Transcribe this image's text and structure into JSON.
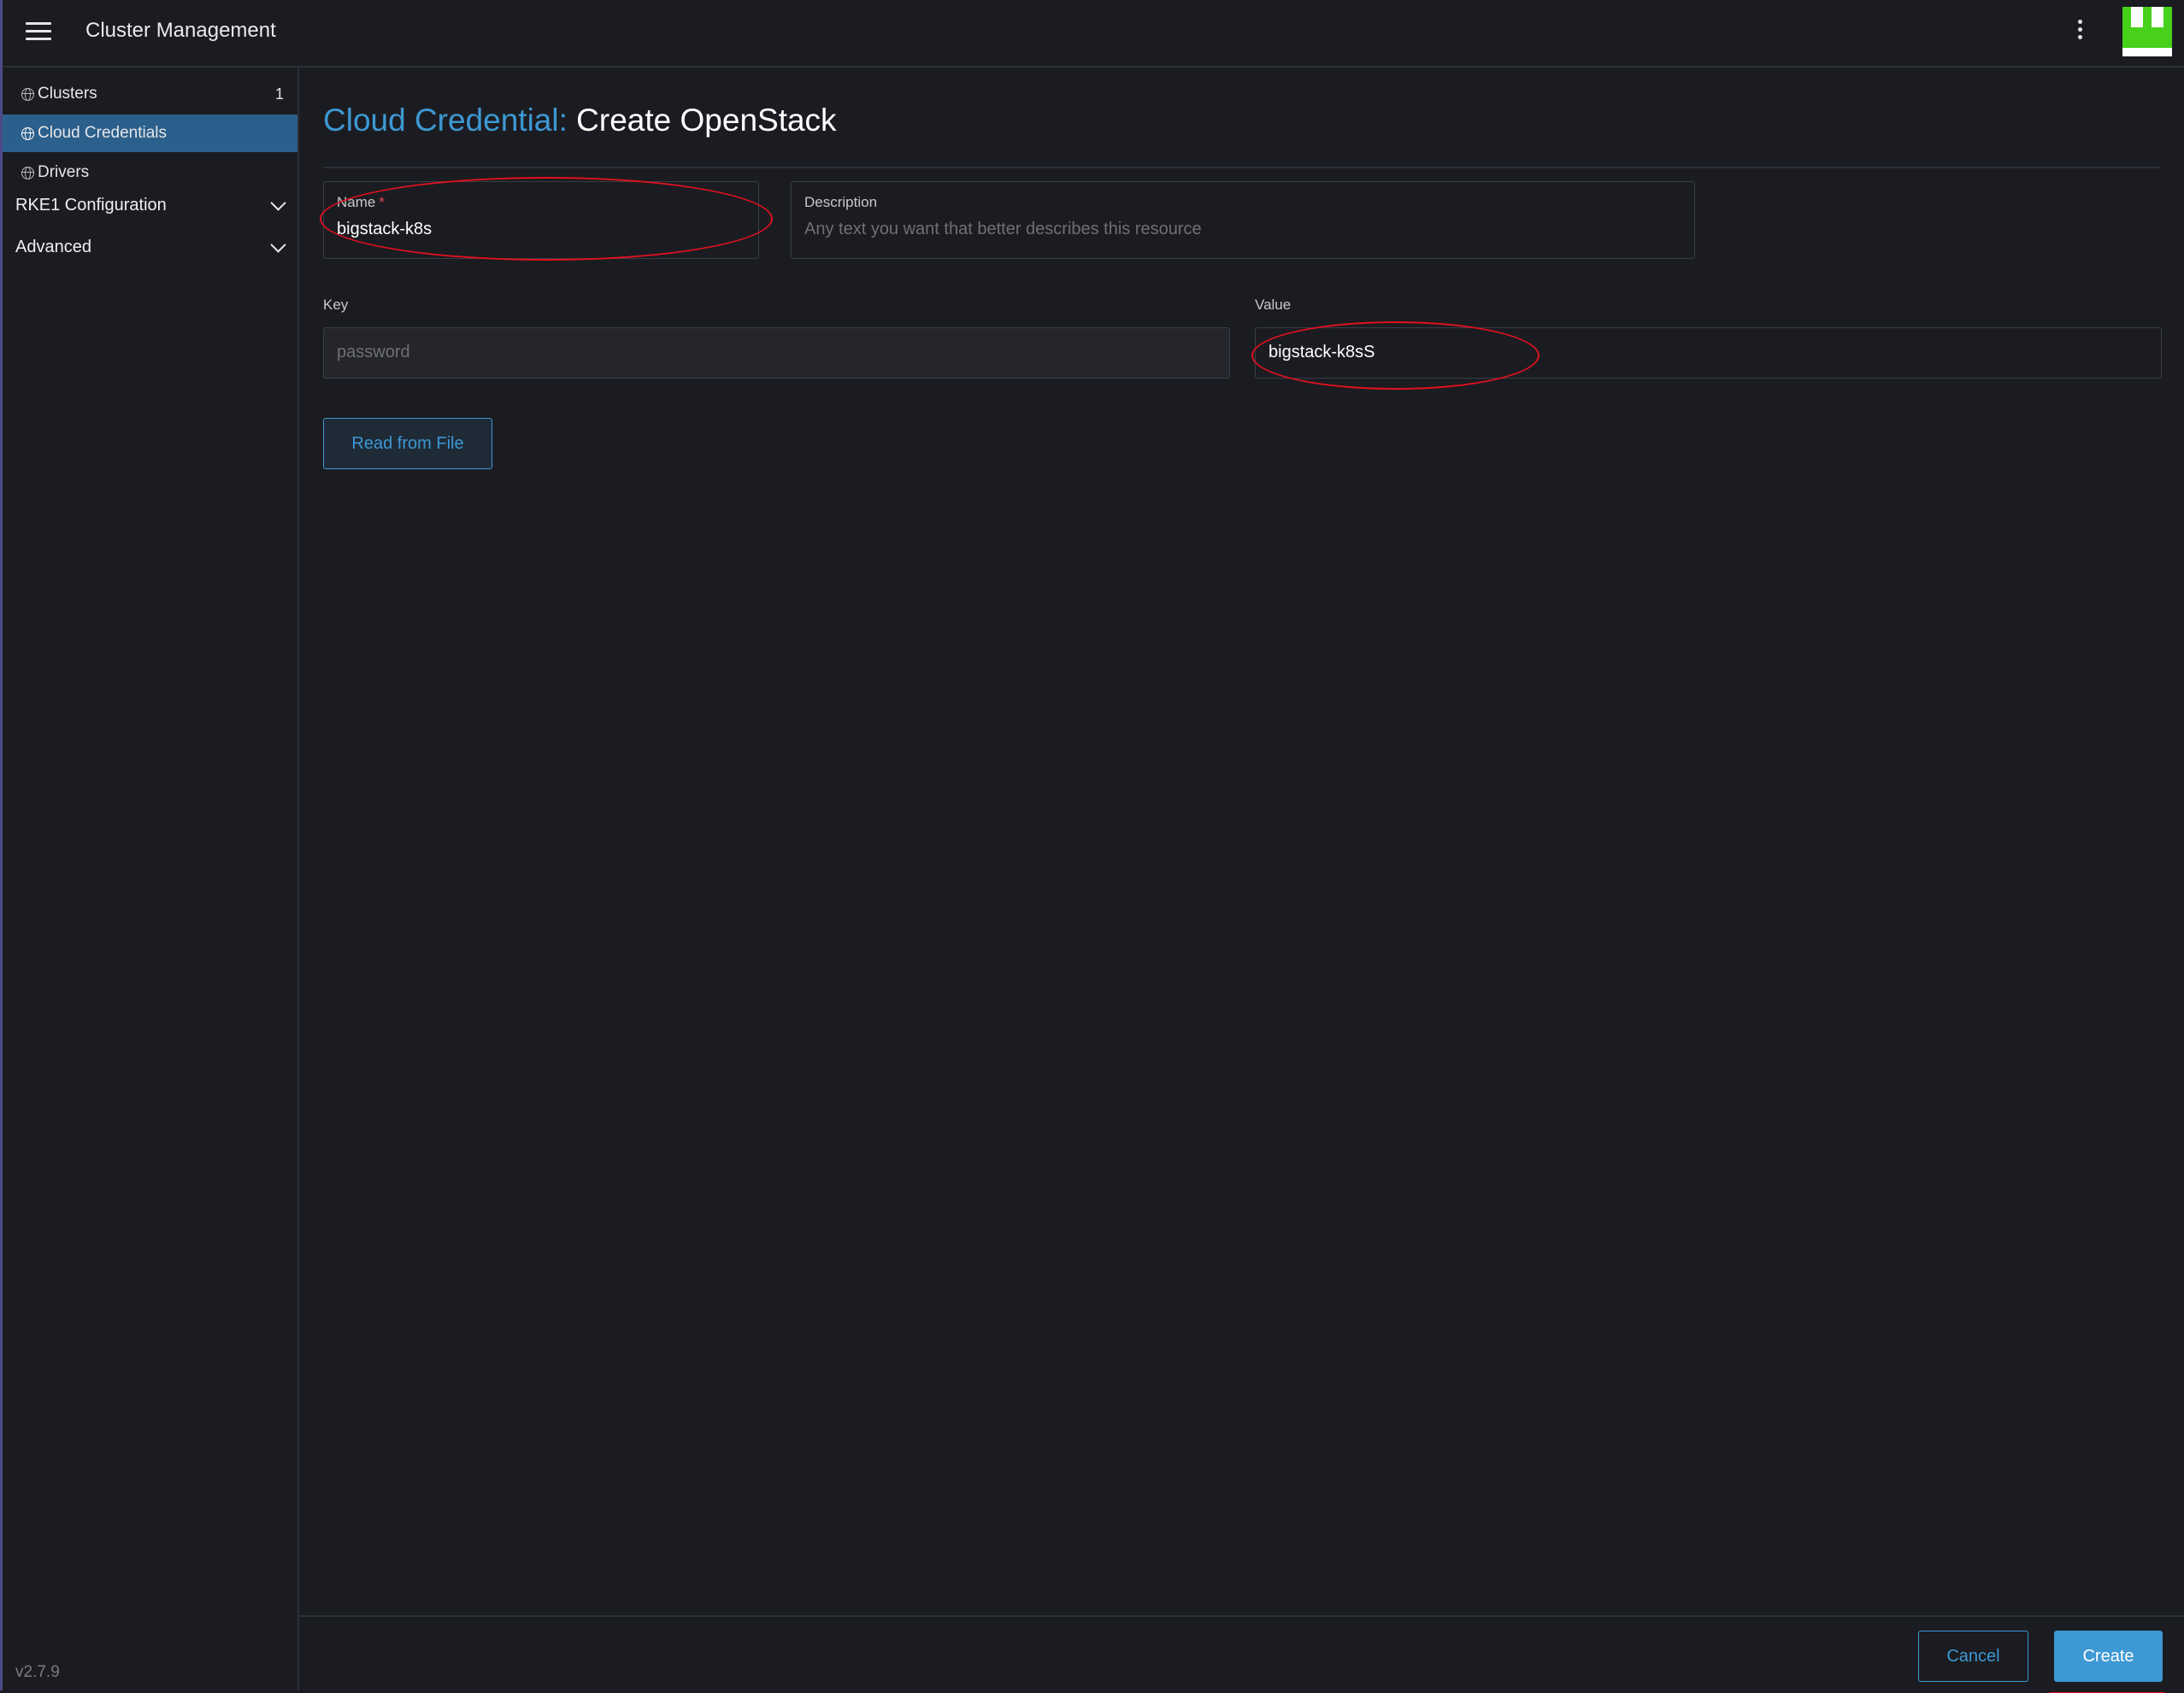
{
  "header": {
    "app_title": "Cluster Management",
    "menu_icon": "hamburger-menu-icon",
    "more_icon": "kebab-menu-icon"
  },
  "sidebar": {
    "items": [
      {
        "label": "Clusters",
        "icon": "globe-icon",
        "count": "1"
      },
      {
        "label": "Cloud Credentials",
        "icon": "globe-icon",
        "active": true
      },
      {
        "label": "Drivers",
        "icon": "globe-icon"
      }
    ],
    "groups": [
      {
        "label": "RKE1 Configuration",
        "icon": "chevron-down-icon"
      },
      {
        "label": "Advanced",
        "icon": "chevron-down-icon"
      }
    ],
    "version": "v2.7.9"
  },
  "page": {
    "crumb": "Cloud Credential:",
    "title": "Create OpenStack"
  },
  "form": {
    "name": {
      "label": "Name",
      "required_mark": "*",
      "value": "bigstack-k8s"
    },
    "description": {
      "label": "Description",
      "placeholder": "Any text you want that better describes this resource"
    },
    "key": {
      "label": "Key",
      "placeholder": "password"
    },
    "value": {
      "label": "Value",
      "value": "bigstack-k8sS"
    },
    "read_from_file_label": "Read from File"
  },
  "footer": {
    "cancel_label": "Cancel",
    "create_label": "Create"
  },
  "colors": {
    "accent": "#3d98d3",
    "active_nav": "#2b5f8c",
    "background": "#1b1c21",
    "annotation": "#e0111f"
  }
}
